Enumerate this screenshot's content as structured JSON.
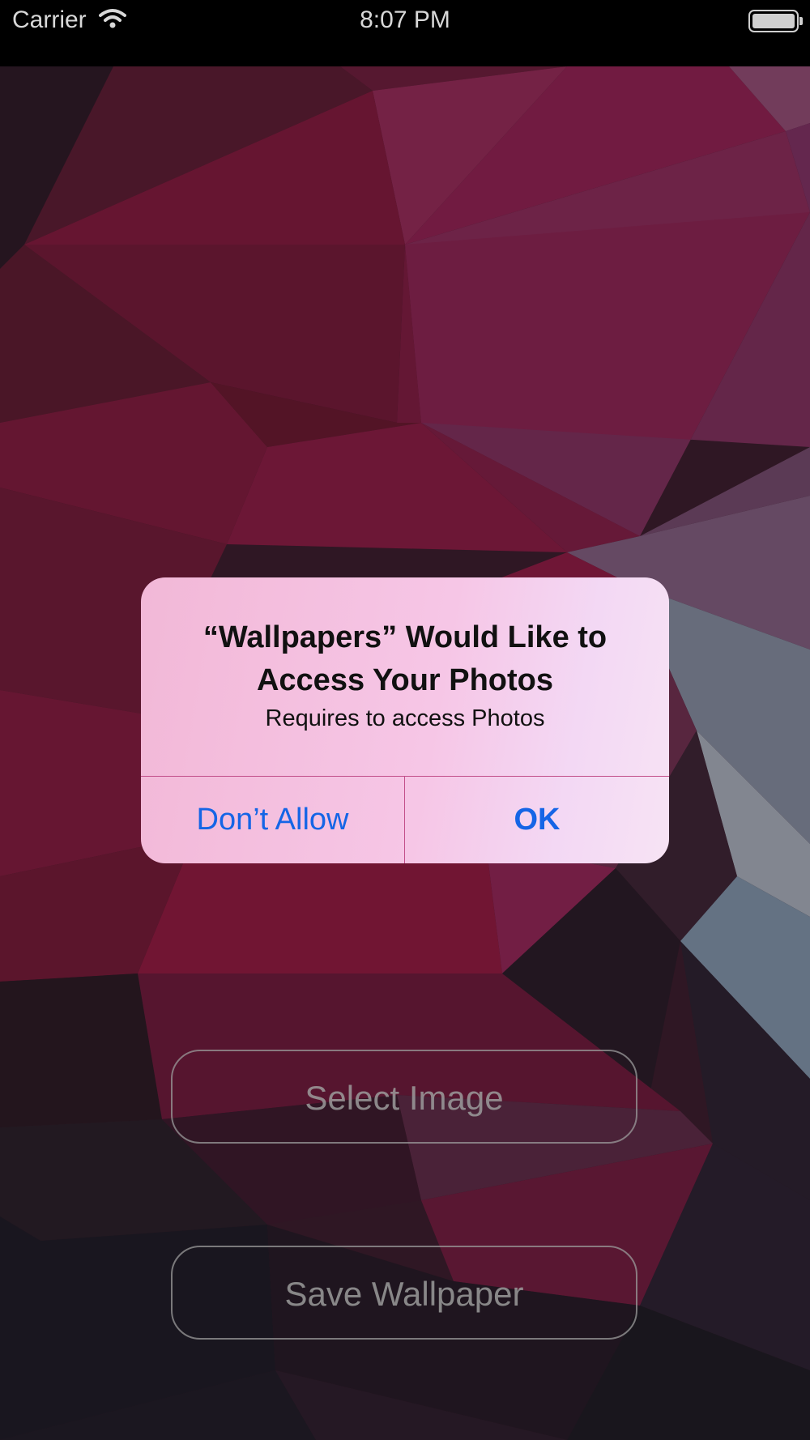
{
  "status_bar": {
    "carrier": "Carrier",
    "time": "8:07 PM",
    "icons": [
      "wifi-icon",
      "battery-icon"
    ]
  },
  "main": {
    "select_image_label": "Select Image",
    "save_wallpaper_label": "Save Wallpaper"
  },
  "alert": {
    "title": "“Wallpapers” Would Like to Access Your Photos",
    "message": "Requires to access Photos",
    "deny_label": "Don’t Allow",
    "ok_label": "OK"
  },
  "colors": {
    "accent": "#1565e6",
    "separator": "#c24f8a",
    "button_outline": "#bebebe"
  }
}
